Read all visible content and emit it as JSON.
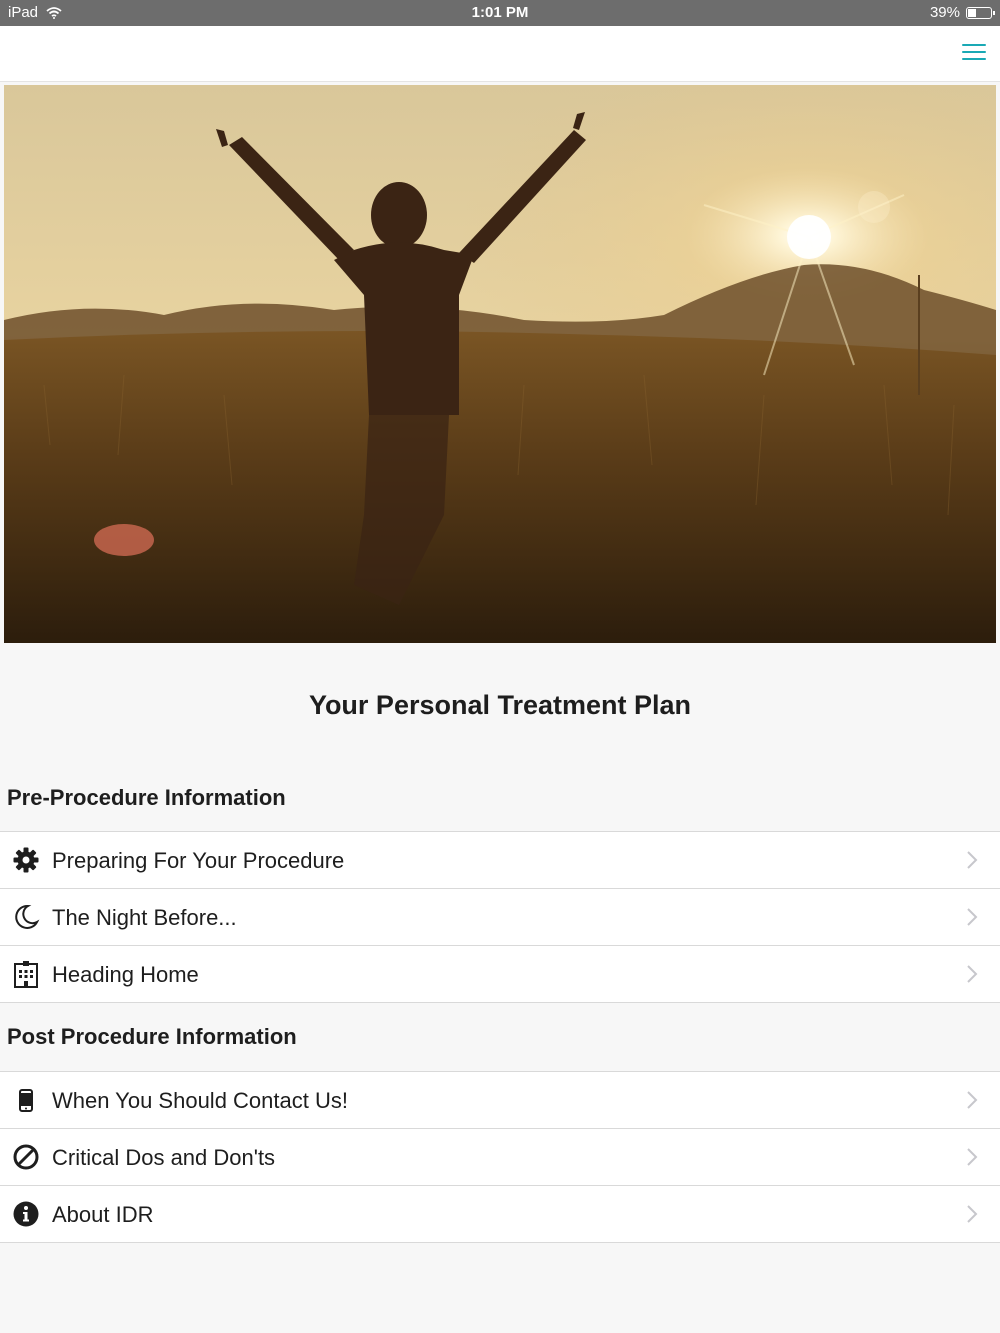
{
  "status_bar": {
    "device": "iPad",
    "time": "1:01 PM",
    "battery": "39%",
    "battery_level": 0.39,
    "icons": [
      "wifi-icon",
      "battery-icon"
    ]
  },
  "nav": {
    "menu_icon": "hamburger-menu-icon",
    "accent_color": "#1aa9b5"
  },
  "hero": {
    "subject": "person-arms-raised-sunset-field"
  },
  "page_title": "Your Personal Treatment Plan",
  "sections": [
    {
      "title": "Pre-Procedure Information",
      "items": [
        {
          "label": "Preparing For Your Procedure",
          "icon": "gear-icon"
        },
        {
          "label": "The Night Before...",
          "icon": "moon-icon"
        },
        {
          "label": "Heading Home",
          "icon": "hospital-building-icon"
        }
      ]
    },
    {
      "title": "Post Procedure Information",
      "items": [
        {
          "label": "When You Should Contact Us!",
          "icon": "mobile-phone-icon"
        },
        {
          "label": "Critical Dos and Don'ts",
          "icon": "prohibited-icon"
        },
        {
          "label": "About IDR",
          "icon": "info-icon"
        }
      ]
    }
  ]
}
